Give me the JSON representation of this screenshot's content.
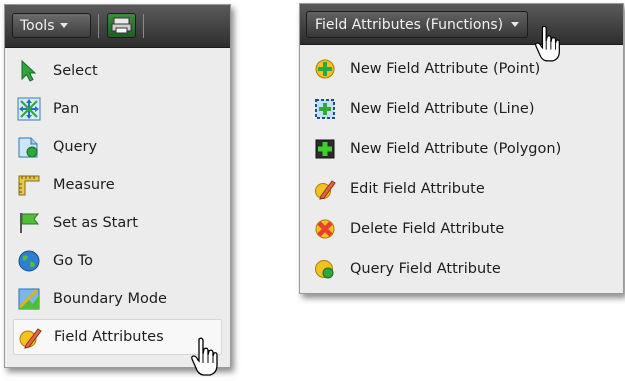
{
  "tools_menu": {
    "button_label": "Tools",
    "items": [
      {
        "label": "Select",
        "icon": "select-arrow-icon"
      },
      {
        "label": "Pan",
        "icon": "pan-icon"
      },
      {
        "label": "Query",
        "icon": "query-icon"
      },
      {
        "label": "Measure",
        "icon": "measure-icon"
      },
      {
        "label": "Set as Start",
        "icon": "flag-icon"
      },
      {
        "label": "Go To",
        "icon": "globe-icon"
      },
      {
        "label": "Boundary Mode",
        "icon": "boundary-icon"
      },
      {
        "label": "Field Attributes",
        "icon": "field-attributes-icon"
      }
    ],
    "highlighted_item": "Field Attributes"
  },
  "field_attributes_menu": {
    "button_label": "Field Attributes (Functions)",
    "items": [
      {
        "label": "New Field Attribute (Point)",
        "icon": "new-point-icon"
      },
      {
        "label": "New Field Attribute (Line)",
        "icon": "new-line-icon"
      },
      {
        "label": "New Field Attribute (Polygon)",
        "icon": "new-polygon-icon"
      },
      {
        "label": "Edit Field Attribute",
        "icon": "edit-icon"
      },
      {
        "label": "Delete Field Attribute",
        "icon": "delete-icon"
      },
      {
        "label": "Query Field Attribute",
        "icon": "query-icon"
      }
    ]
  },
  "colors": {
    "toolbar": "#3a3a3a",
    "menu_background": "#ececec",
    "text": "#1e1e1e",
    "highlight": "#f8f8f8"
  }
}
